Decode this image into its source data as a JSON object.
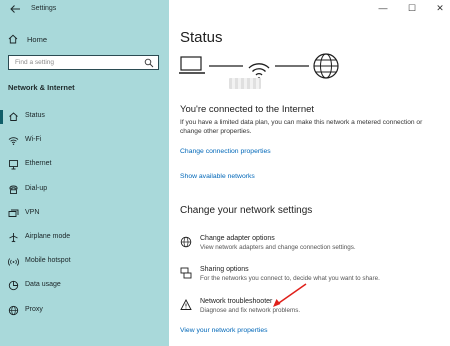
{
  "window": {
    "title": "Settings",
    "minimize": "—",
    "maximize": "☐",
    "close": "✕"
  },
  "sidebar": {
    "home_label": "Home",
    "search_placeholder": "Find a setting",
    "section_title": "Network & Internet",
    "items": [
      {
        "label": "Status",
        "icon": "home-status-icon",
        "active": true
      },
      {
        "label": "Wi-Fi",
        "icon": "wifi-icon"
      },
      {
        "label": "Ethernet",
        "icon": "ethernet-icon"
      },
      {
        "label": "Dial-up",
        "icon": "dialup-icon"
      },
      {
        "label": "VPN",
        "icon": "vpn-icon"
      },
      {
        "label": "Airplane mode",
        "icon": "airplane-icon"
      },
      {
        "label": "Mobile hotspot",
        "icon": "hotspot-icon"
      },
      {
        "label": "Data usage",
        "icon": "data-usage-icon"
      },
      {
        "label": "Proxy",
        "icon": "proxy-icon"
      }
    ]
  },
  "main": {
    "title": "Status",
    "connected_heading": "You're connected to the Internet",
    "connected_text": "If you have a limited data plan, you can make this network a metered connection or change other properties.",
    "link_change_connection": "Change connection properties",
    "link_show_networks": "Show available networks",
    "section_heading": "Change your network settings",
    "options": [
      {
        "title": "Change adapter options",
        "desc": "View network adapters and change connection settings.",
        "icon": "adapter-icon"
      },
      {
        "title": "Sharing options",
        "desc": "For the networks you connect to, decide what you want to share.",
        "icon": "sharing-icon"
      },
      {
        "title": "Network troubleshooter",
        "desc": "Diagnose and fix network problems.",
        "icon": "warning-icon"
      }
    ],
    "link_view_properties": "View your network properties"
  },
  "colors": {
    "sidebar_bg": "#a9d9da",
    "accent": "#0067b8",
    "arrow": "#e0201a"
  }
}
